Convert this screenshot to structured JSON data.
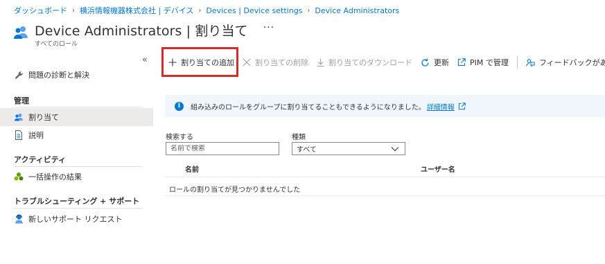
{
  "breadcrumb": [
    "ダッシュボード",
    "横浜情報機器株式会社 | デバイス",
    "Devices | Device settings",
    "Device Administrators"
  ],
  "header": {
    "title": "Device Administrators | 割り当て",
    "subtitle": "すべてのロール",
    "more": "···"
  },
  "sidebar": {
    "collapse": "«",
    "diagnose": "問題の診断と解決",
    "group_manage": "管理",
    "assignments": "割り当て",
    "description": "説明",
    "group_activity": "アクティビティ",
    "bulk_results": "一括操作の結果",
    "group_support": "トラブルシューティング + サポート",
    "new_support": "新しいサポート リクエスト"
  },
  "toolbar": {
    "add": "割り当ての追加",
    "remove": "割り当ての削除",
    "download": "割り当てのダウンロード",
    "refresh": "更新",
    "pim": "PIM で管理",
    "feedback": "フィードバックがある場合"
  },
  "info": {
    "text": "組み込みのロールをグループに割り当てることもできるようになりました。",
    "link": "詳細情報"
  },
  "filters": {
    "search_label": "検索する",
    "search_placeholder": "名前で検索",
    "type_label": "種類",
    "type_value": "すべて"
  },
  "table": {
    "headers": [
      "名前",
      "ユーザー名"
    ],
    "empty": "ロールの割り当てが見つかりませんでした"
  },
  "colors": {
    "accent": "#0078d4",
    "highlight": "#d42b2b",
    "info_bg": "#eff6fc",
    "active_bg": "#edebe9"
  }
}
